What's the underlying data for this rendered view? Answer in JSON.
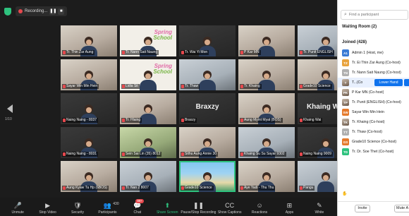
{
  "topbar": {
    "recording_label": "Recording...",
    "pause_glyph": "❚❚",
    "stop_glyph": "■"
  },
  "page_indicator": "1/10",
  "tiles": [
    {
      "label": "Tr. Thin Zar Aung",
      "style": "video"
    },
    {
      "label": "Tr. Nann Sait Naung",
      "style": "school"
    },
    {
      "label": "Tr. Wai Yi Mon",
      "style": "dark"
    },
    {
      "label": "P Kar MN",
      "style": "video"
    },
    {
      "label": "Tr. Punit ENGLISH",
      "style": "cool"
    },
    {
      "label": "Sayar Win Min Hein",
      "style": "video"
    },
    {
      "label": "Lidia Sit",
      "style": "school"
    },
    {
      "label": "Tr. Thaw",
      "style": "cool"
    },
    {
      "label": "Tr. Khaing",
      "style": "video"
    },
    {
      "label": "Grade10 Science",
      "style": "video"
    },
    {
      "label": "Naing Naing - 8037",
      "style": "dark"
    },
    {
      "label": "Tr. Hlaing",
      "style": "video"
    },
    {
      "label": "Braxzy",
      "style": "dark",
      "big_name": "Braxzy"
    },
    {
      "label": "Aung Myint Myat (BOS)",
      "style": "video"
    },
    {
      "label": "Khaing Wai",
      "style": "dark",
      "big_name": "Khaing Wai"
    },
    {
      "label": "Naing Naing - 8031",
      "style": "dark"
    },
    {
      "label": "Sein Sai Lin (35) 8012",
      "style": "green"
    },
    {
      "label": "Sithu Aung Annie 30",
      "style": "video"
    },
    {
      "label": "Khaing Su Su Sayar 9302",
      "style": "cool"
    },
    {
      "label": "Naing Naing 9009",
      "style": "dark"
    },
    {
      "label": "Aung Kyaw Tu Hp (6BOS)",
      "style": "video"
    },
    {
      "label": "Tr. Nan 2 8007",
      "style": "cool"
    },
    {
      "label": "Grade10 Science",
      "style": "beach",
      "active": true
    },
    {
      "label": "Aye Yadi - Thu Thu",
      "style": "video"
    },
    {
      "label": "Pangu",
      "style": "cool"
    }
  ],
  "toolbar": [
    {
      "key": "unmute",
      "glyph": "🎤",
      "label": "Unmute"
    },
    {
      "key": "stop-video",
      "glyph": "▶",
      "label": "Stop Video"
    },
    {
      "key": "security",
      "glyph": "🛡",
      "label": "Security"
    },
    {
      "key": "participants",
      "glyph": "👥",
      "label": "Participants",
      "count": "430"
    },
    {
      "key": "chat",
      "glyph": "💬",
      "label": "Chat",
      "badge": "99+"
    },
    {
      "key": "share-screen",
      "glyph": "⬆",
      "label": "Share Screen",
      "green": true
    },
    {
      "key": "pause-stop-recording",
      "glyph": "❚❚",
      "label": "Pause/Stop Recording"
    },
    {
      "key": "show-captions",
      "glyph": "CC",
      "label": "Show Captions"
    },
    {
      "key": "reactions",
      "glyph": "☺",
      "label": "Reactions"
    },
    {
      "key": "apps",
      "glyph": "⊞",
      "label": "Apps"
    },
    {
      "key": "whiteboards",
      "glyph": "✎",
      "label": "White"
    }
  ],
  "panel": {
    "search_placeholder": "Find a participant",
    "waiting_room_label": "Waiting Room (2)",
    "joined_label": "Joined (428)",
    "participants": [
      {
        "initials": "A1",
        "name": "Admin 1 (Host, me)",
        "color": "#3a7bd5"
      },
      {
        "initials": "TZ",
        "name": "Tr. Ei Thin Zar Aung (Co-host)",
        "color": "#e8a33d"
      },
      {
        "initials": "TN",
        "name": "Tr. Nann Sait Naung (Co-host)",
        "color": "#b0b0b0"
      },
      {
        "initials": "T",
        "name": "T...(Co",
        "color": "photo",
        "selected": true,
        "action_label": "Lower Hand"
      },
      {
        "initials": "PK",
        "name": "P Kar MN (Co-host)",
        "color": "photo"
      },
      {
        "initials": "TP",
        "name": "Tr. Punit (ENGLISH) (Co-host)",
        "color": "photo"
      },
      {
        "initials": "SW",
        "name": "Sayar Win Min Hein",
        "color": "#e57a2c"
      },
      {
        "initials": "TK",
        "name": "Tr. Khaing (Co-host)",
        "color": "photo"
      },
      {
        "initials": "TT",
        "name": "Tr. Thaw (Co-host)",
        "color": "#b0b0b0"
      },
      {
        "initials": "GS",
        "name": "Grade10 Science (Co-host)",
        "color": "#e57a2c"
      },
      {
        "initials": "TD",
        "name": "Tr. Dr. Soe Thet (Co-host)",
        "color": "#2ec27e"
      }
    ],
    "hand_glyph": "✋",
    "invite_label": "Invite",
    "mute_all_label": "Mute A"
  }
}
